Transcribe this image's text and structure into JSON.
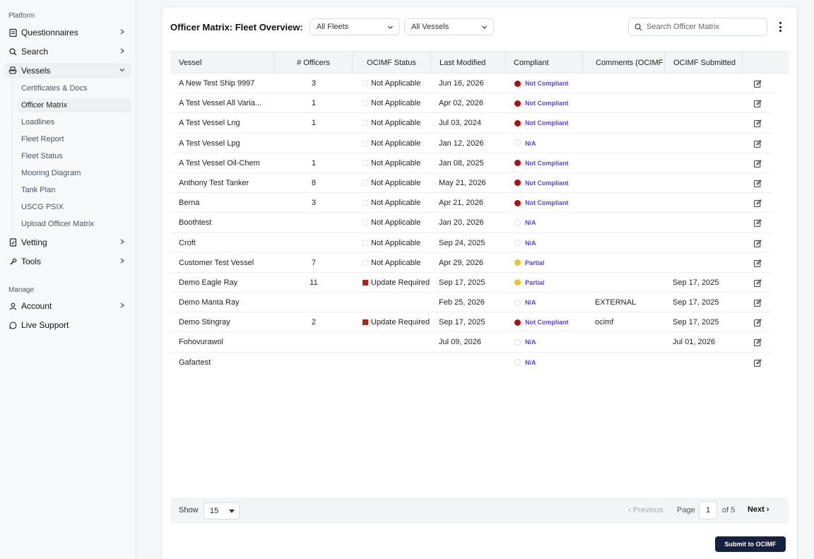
{
  "sidebar": {
    "section_platform": "Platform",
    "section_manage": "Manage",
    "items": {
      "questionnaires": "Questionnaires",
      "search": "Search",
      "vessels": "Vessels",
      "vetting": "Vetting",
      "tools": "Tools",
      "account": "Account",
      "live_support": "Live Support"
    },
    "vessel_sub": [
      "Certificates & Docs",
      "Officer Matrix",
      "Loadlines",
      "Fleet Report",
      "Fleet Status",
      "Mooring Diagram",
      "Tank Plan",
      "USCG PSIX",
      "Upload Officer Matrix"
    ],
    "active_sub": "Officer Matrix"
  },
  "header": {
    "title": "Officer Matrix: Fleet Overview:",
    "fleet_filter": "All Fleets",
    "vessel_filter": "All Vessels",
    "search_placeholder": "Search Officer Matrix"
  },
  "table": {
    "columns": [
      "Vessel",
      "# Officers",
      "OCIMF Status",
      "Last Modified",
      "Compliant",
      "Comments (OCIMF",
      "OCIMF Submitted"
    ],
    "rows": [
      {
        "vessel": "A New Test Ship 9997",
        "officers": "3",
        "status": "Not Applicable",
        "status_type": "empty",
        "modified": "Jun 16, 2026",
        "compliant": "Not Compliant",
        "compliant_type": "red",
        "comments": "",
        "submitted": ""
      },
      {
        "vessel": "A Test Vessel All Varia...",
        "officers": "1",
        "status": "Not Applicable",
        "status_type": "empty",
        "modified": "Apr 02, 2026",
        "compliant": "Not Compliant",
        "compliant_type": "red",
        "comments": "",
        "submitted": ""
      },
      {
        "vessel": "A Test Vessel Lng",
        "officers": "1",
        "status": "Not Applicable",
        "status_type": "empty",
        "modified": "Jul 03, 2024",
        "compliant": "Not Compliant",
        "compliant_type": "red",
        "comments": "",
        "submitted": ""
      },
      {
        "vessel": "A Test Vessel Lpg",
        "officers": "",
        "status": "Not Applicable",
        "status_type": "empty",
        "modified": "Jan 12, 2026",
        "compliant": "N/A",
        "compliant_type": "na",
        "comments": "",
        "submitted": ""
      },
      {
        "vessel": "A Test Vessel Oil-Chem",
        "officers": "1",
        "status": "Not Applicable",
        "status_type": "empty",
        "modified": "Jan 08, 2025",
        "compliant": "Not Compliant",
        "compliant_type": "red",
        "comments": "",
        "submitted": ""
      },
      {
        "vessel": "Anthony Test Tanker",
        "officers": "8",
        "status": "Not Applicable",
        "status_type": "empty",
        "modified": "May 21, 2026",
        "compliant": "Not Compliant",
        "compliant_type": "red",
        "comments": "",
        "submitted": ""
      },
      {
        "vessel": "Berna",
        "officers": "3",
        "status": "Not Applicable",
        "status_type": "empty",
        "modified": "Apr 21, 2026",
        "compliant": "Not Compliant",
        "compliant_type": "red",
        "comments": "",
        "submitted": ""
      },
      {
        "vessel": "Boothtest",
        "officers": "",
        "status": "Not Applicable",
        "status_type": "empty",
        "modified": "Jan 20, 2026",
        "compliant": "N/A",
        "compliant_type": "na",
        "comments": "",
        "submitted": ""
      },
      {
        "vessel": "Croft",
        "officers": "",
        "status": "Not Applicable",
        "status_type": "empty",
        "modified": "Sep 24, 2025",
        "compliant": "N/A",
        "compliant_type": "na",
        "comments": "",
        "submitted": ""
      },
      {
        "vessel": "Customer Test Vessel",
        "officers": "7",
        "status": "Not Applicable",
        "status_type": "empty",
        "modified": "Apr 29, 2026",
        "compliant": "Partial",
        "compliant_type": "yellow",
        "comments": "",
        "submitted": ""
      },
      {
        "vessel": "Demo Eagle Ray",
        "officers": "11",
        "status": "Update Required",
        "status_type": "red",
        "modified": "Sep 17, 2025",
        "compliant": "Partial",
        "compliant_type": "yellow",
        "comments": "",
        "submitted": "Sep 17, 2025"
      },
      {
        "vessel": "Demo Manta Ray",
        "officers": "",
        "status": "",
        "status_type": "none",
        "modified": "Feb 25, 2026",
        "compliant": "N/A",
        "compliant_type": "na",
        "comments": "EXTERNAL",
        "submitted": "Sep 17, 2025"
      },
      {
        "vessel": "Demo Stingray",
        "officers": "2",
        "status": "Update Required",
        "status_type": "red",
        "modified": "Sep 17, 2025",
        "compliant": "Not Compliant",
        "compliant_type": "red",
        "comments": "ocimf",
        "submitted": "Sep 17, 2025"
      },
      {
        "vessel": "Fohovurawol",
        "officers": "",
        "status": "",
        "status_type": "none",
        "modified": "Jul 09, 2026",
        "compliant": "N/A",
        "compliant_type": "na",
        "comments": "",
        "submitted": "Jul 01, 2026"
      },
      {
        "vessel": "Gafartest",
        "officers": "",
        "status": "",
        "status_type": "none",
        "modified": "",
        "compliant": "N/A",
        "compliant_type": "na",
        "comments": "",
        "submitted": ""
      }
    ]
  },
  "pagination": {
    "show_label": "Show",
    "page_size": "15",
    "previous": "‹ Previous",
    "page_label": "Page",
    "current_page": "1",
    "of_label": "of 5",
    "next": "Next ›"
  },
  "actions": {
    "submit": "Submit to OCIMF"
  },
  "colors": {
    "not_compliant": "#b40d0d",
    "partial": "#f2c12e",
    "status_text": "#5b46d4",
    "submit_bg": "#16213e"
  }
}
